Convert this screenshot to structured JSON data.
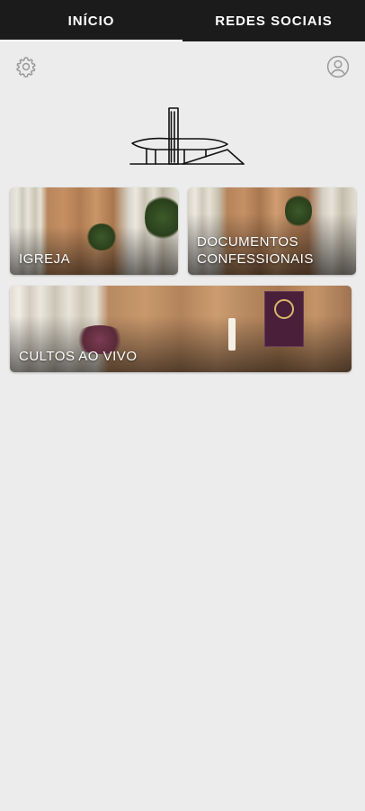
{
  "tabs": [
    {
      "label": "INÍCIO",
      "active": true
    },
    {
      "label": "REDES SOCIAIS",
      "active": false
    }
  ],
  "header": {
    "settings_icon": "gear-icon",
    "profile_icon": "user-circle-icon"
  },
  "logo": {
    "icon": "church-building-logo"
  },
  "cards": {
    "igreja": {
      "label": "IGREJA"
    },
    "documentos": {
      "label_line1": "DOCUMENTOS",
      "label_line2": "CONFESSIONAIS"
    },
    "cultos": {
      "label": "CULTOS AO VIVO"
    }
  },
  "colors": {
    "tabbar": "#1b1b1b",
    "background": "#ececec",
    "tab_text": "#ffffff",
    "icon_gray": "#9a9a9a"
  }
}
